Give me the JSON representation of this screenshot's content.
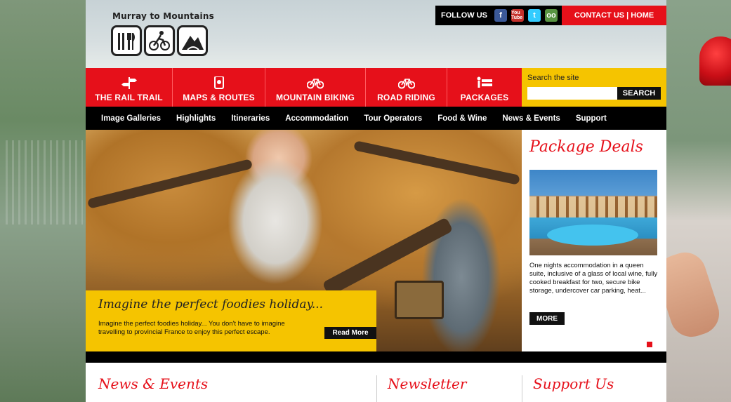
{
  "header": {
    "logo_text": "Murray to Mountains",
    "follow_label": "FOLLOW US",
    "social": [
      {
        "name": "facebook-icon",
        "glyph": "f"
      },
      {
        "name": "youtube-icon",
        "glyph": "You Tube"
      },
      {
        "name": "twitter-icon",
        "glyph": "t"
      },
      {
        "name": "tripadvisor-icon",
        "glyph": "oo"
      }
    ],
    "contact_label": "CONTACT US",
    "separator": "|",
    "home_label": "HOME"
  },
  "main_nav": [
    {
      "label": "THE RAIL TRAIL",
      "icon": "signpost-icon"
    },
    {
      "label": "MAPS & ROUTES",
      "icon": "map-icon"
    },
    {
      "label": "MOUNTAIN BIKING",
      "icon": "bicycle-icon"
    },
    {
      "label": "ROAD RIDING",
      "icon": "bicycle-icon"
    },
    {
      "label": "PACKAGES",
      "icon": "bed-icon"
    }
  ],
  "search": {
    "label": "Search the site",
    "placeholder": "",
    "button": "SEARCH"
  },
  "sub_nav": [
    "Image Galleries",
    "Highlights",
    "Itineraries",
    "Accommodation",
    "Tour Operators",
    "Food & Wine",
    "News & Events",
    "Support"
  ],
  "hero": {
    "title": "Imagine the perfect foodies holiday...",
    "text": "Imagine the perfect foodies holiday... You don't have to imagine travelling to provincial France to enjoy this perfect escape.",
    "button": "Read More"
  },
  "packages": {
    "title": "Package Deals",
    "text": "One nights accommodation in a queen suite, inclusive of a glass of local wine, fully cooked breakfast for two, secure bike storage, undercover car parking, heat...",
    "button": "MORE"
  },
  "bottom": {
    "news": "News & Events",
    "newsletter": "Newsletter",
    "support": "Support Us"
  },
  "colors": {
    "brand_red": "#e6101a",
    "accent_yellow": "#f5c400",
    "nav_black": "#000000"
  }
}
